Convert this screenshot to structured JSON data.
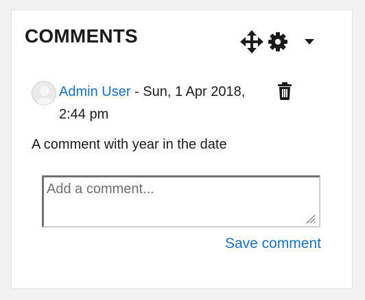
{
  "block": {
    "title": "COMMENTS",
    "controls": {
      "move_icon": "move-arrows-icon",
      "settings_icon": "gear-icon",
      "menu_icon": "caret-down-icon"
    }
  },
  "comment": {
    "author": "Admin User",
    "separator": " - ",
    "date": "Sun, 1 Apr 2018, 2:44 pm",
    "text": "A comment with year in the date",
    "delete_icon": "trash-icon"
  },
  "form": {
    "placeholder": "Add a comment...",
    "value": "",
    "save_label": "Save comment"
  },
  "colors": {
    "link": "#1a6fc0",
    "text": "#1a1a1a",
    "background": "#f2f2f2",
    "panel": "#ffffff"
  }
}
